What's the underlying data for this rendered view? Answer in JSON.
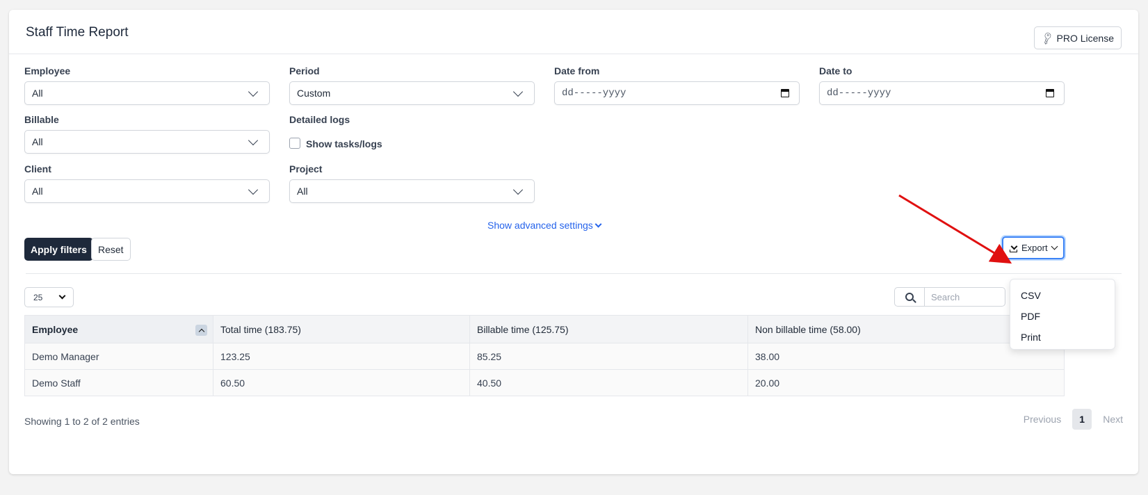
{
  "header": {
    "title": "Staff Time Report",
    "pro_label": "PRO License"
  },
  "filters": {
    "employee": {
      "label": "Employee",
      "value": "All"
    },
    "period": {
      "label": "Period",
      "value": "Custom"
    },
    "date_from": {
      "label": "Date from",
      "placeholder": "dd-----yyyy"
    },
    "date_to": {
      "label": "Date to",
      "placeholder": "dd-----yyyy"
    },
    "billable": {
      "label": "Billable",
      "value": "All"
    },
    "detailed_logs": {
      "label": "Detailed logs",
      "checkbox_label": "Show tasks/logs",
      "checked": false
    },
    "client": {
      "label": "Client",
      "value": "All"
    },
    "project": {
      "label": "Project",
      "value": "All"
    },
    "advanced_link": "Show advanced settings"
  },
  "actions": {
    "apply": "Apply filters",
    "reset": "Reset",
    "export": "Export"
  },
  "export_menu": {
    "items": [
      "CSV",
      "PDF",
      "Print"
    ]
  },
  "table_controls": {
    "page_length": "25",
    "search_placeholder": "Search"
  },
  "table": {
    "columns": [
      "Employee",
      "Total time (183.75)",
      "Billable time (125.75)",
      "Non billable time (58.00)"
    ],
    "rows": [
      [
        "Demo Manager",
        "123.25",
        "85.25",
        "38.00"
      ],
      [
        "Demo Staff",
        "60.50",
        "40.50",
        "20.00"
      ]
    ]
  },
  "footer": {
    "info": "Showing 1 to 2 of 2 entries",
    "prev": "Previous",
    "current_page": "1",
    "next": "Next"
  },
  "colors": {
    "accent": "#2563eb",
    "dark_button": "#1e293b",
    "arrow": "#e01010"
  }
}
